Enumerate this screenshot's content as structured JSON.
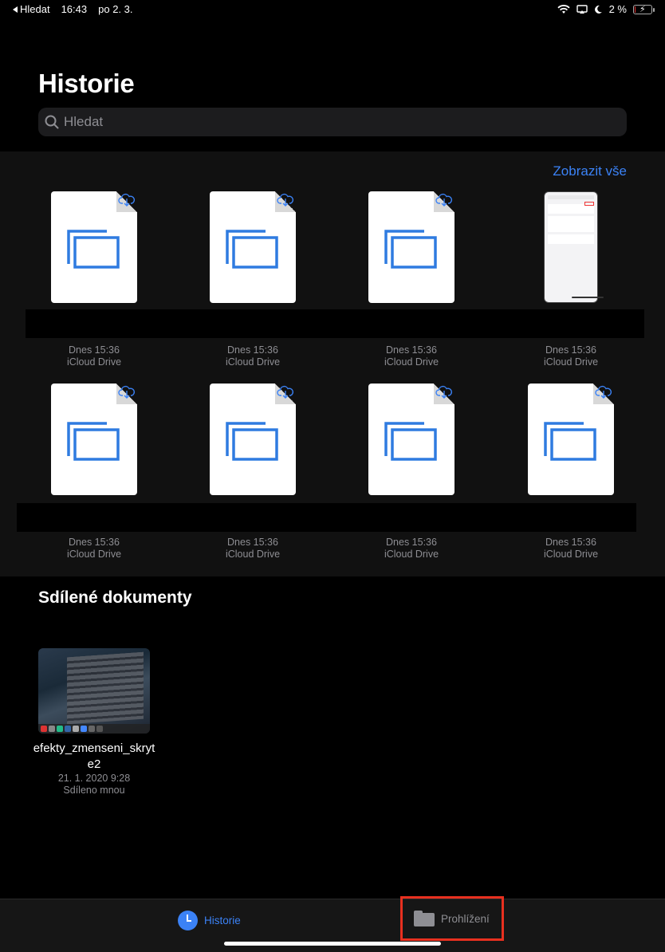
{
  "status_bar": {
    "back_label": "Hledat",
    "time": "16:43",
    "date": "po 2. 3.",
    "battery": "2 %",
    "battery_level_percent": 2
  },
  "header": {
    "title": "Historie",
    "search_placeholder": "Hledat"
  },
  "recents": {
    "show_all_label": "Zobrazit vše",
    "files": [
      {
        "date": "Dnes 15:36",
        "location": "iCloud Drive",
        "icon": "document-cloud-icon"
      },
      {
        "date": "Dnes 15:36",
        "location": "iCloud Drive",
        "icon": "document-cloud-icon"
      },
      {
        "date": "Dnes 15:36",
        "location": "iCloud Drive",
        "icon": "document-cloud-icon"
      },
      {
        "date": "Dnes 15:36",
        "location": "iCloud Drive",
        "icon": "phone-screenshot-thumbnail"
      },
      {
        "date": "Dnes 15:36",
        "location": "iCloud Drive",
        "icon": "document-cloud-icon"
      },
      {
        "date": "Dnes 15:36",
        "location": "iCloud Drive",
        "icon": "document-cloud-icon"
      },
      {
        "date": "Dnes 15:36",
        "location": "iCloud Drive",
        "icon": "document-cloud-icon"
      },
      {
        "date": "Dnes 15:36",
        "location": "iCloud Drive",
        "icon": "document-cloud-icon"
      }
    ]
  },
  "shared": {
    "title": "Sdílené dokumenty",
    "items": [
      {
        "name": "efekty_zmenseni_skryte2",
        "date": "21. 1. 2020 9:28",
        "status": "Sdíleno mnou"
      }
    ]
  },
  "tabbar": {
    "history_label": "Historie",
    "browse_label": "Prohlížení"
  },
  "colors": {
    "accent": "#3b82f6",
    "highlight_box": "#e8301f",
    "background": "#000000"
  }
}
